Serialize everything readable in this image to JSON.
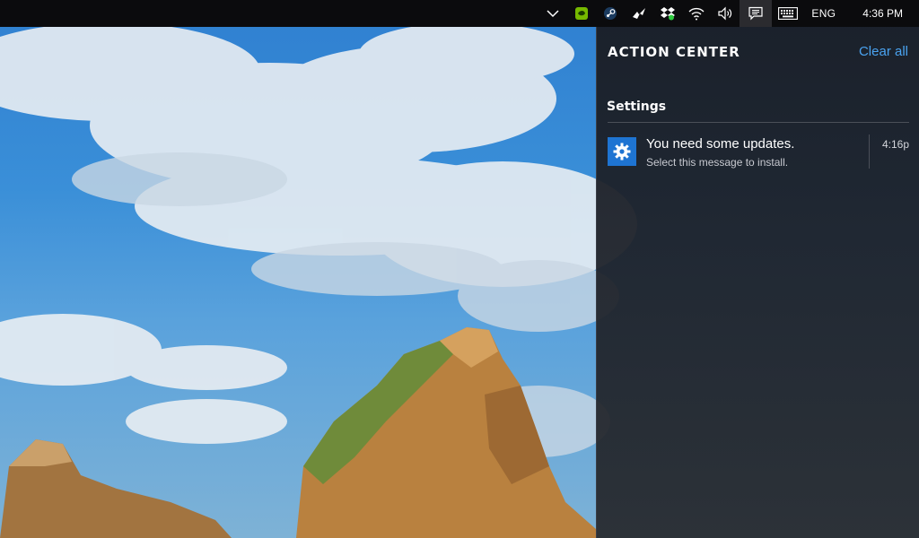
{
  "colors": {
    "taskbar": "#0b0b0d",
    "accent_link": "#4aa3f0",
    "notification_icon_bg": "#1e74d2",
    "panel_bg": "#1c2028"
  },
  "taskbar": {
    "tray_icons": [
      {
        "name": "chevron-up-icon"
      },
      {
        "name": "nvidia-icon"
      },
      {
        "name": "steam-icon"
      },
      {
        "name": "bird-app-icon"
      },
      {
        "name": "dropbox-icon"
      },
      {
        "name": "network-icon"
      },
      {
        "name": "volume-icon"
      },
      {
        "name": "action-center-icon"
      },
      {
        "name": "keyboard-icon"
      }
    ],
    "language": "ENG",
    "clock": "4:36 PM"
  },
  "action_center": {
    "title": "ACTION CENTER",
    "clear_all": "Clear all",
    "groups": [
      {
        "label": "Settings",
        "notifications": [
          {
            "icon": "gear-icon",
            "title": "You need some updates.",
            "subtitle": "Select this message to install.",
            "time": "4:16p"
          }
        ]
      }
    ]
  }
}
